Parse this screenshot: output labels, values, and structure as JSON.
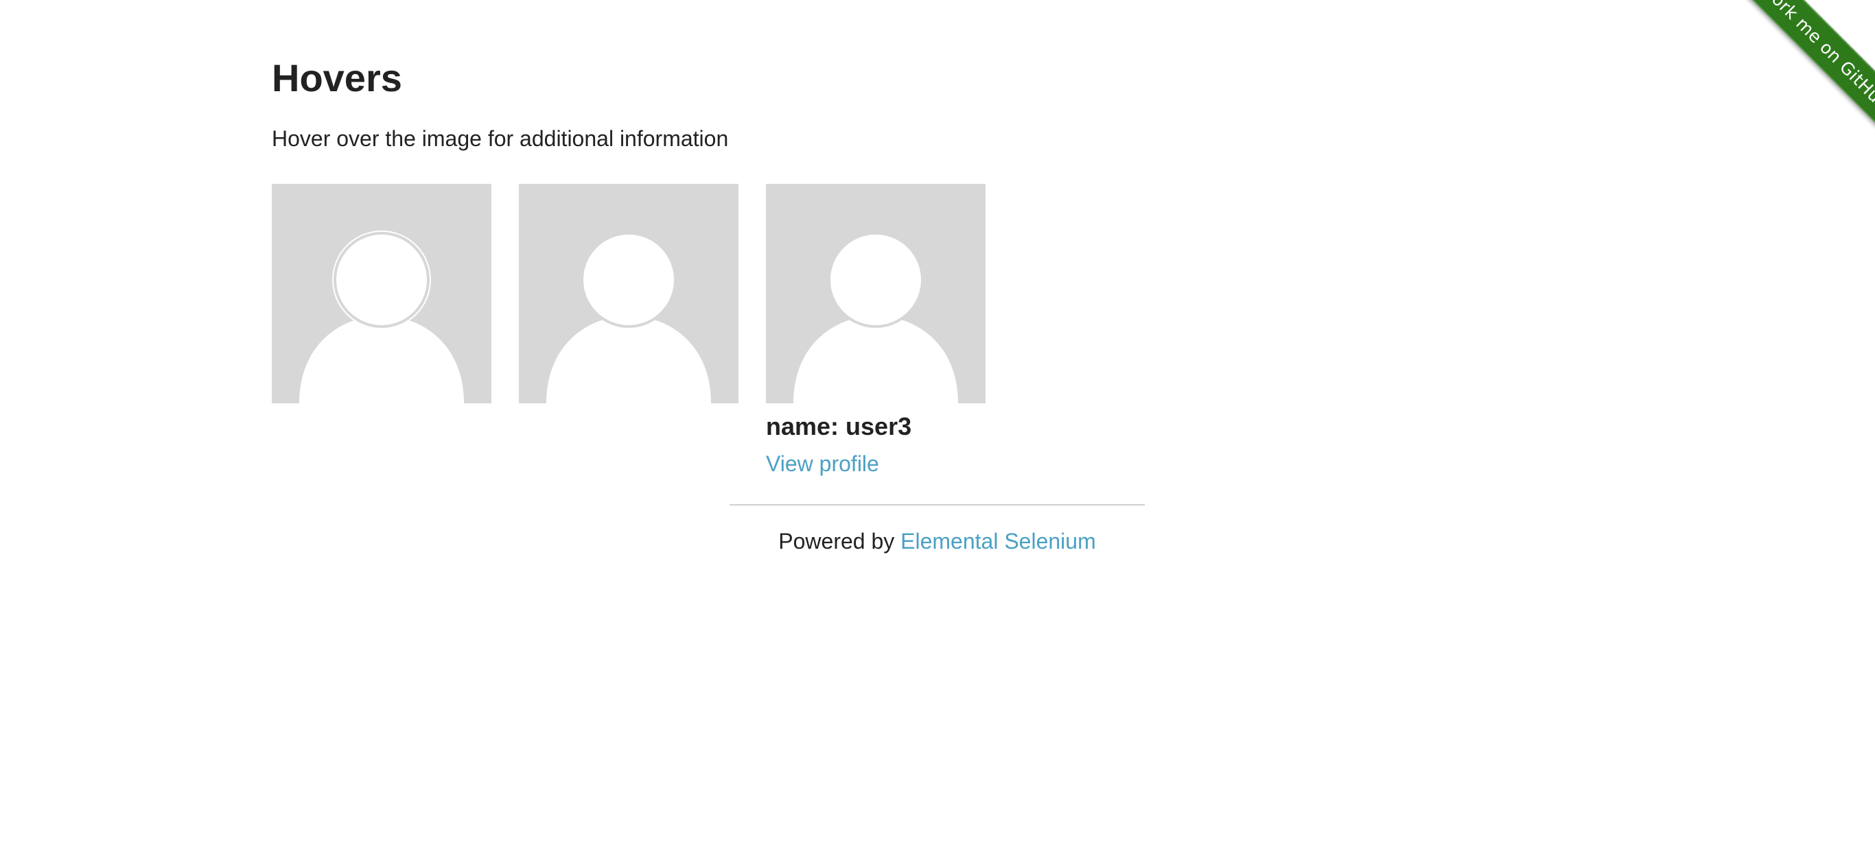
{
  "ribbon": {
    "label": "Fork me on GitHub",
    "color": "#2e7a1b"
  },
  "header": {
    "title": "Hovers"
  },
  "intro": {
    "text": "Hover over the image for additional information"
  },
  "figures": [
    {
      "avatar_icon": "user-avatar-icon"
    },
    {
      "avatar_icon": "user-avatar-icon"
    },
    {
      "avatar_icon": "user-avatar-icon",
      "caption_name": "name: user3",
      "caption_link": "View profile"
    }
  ],
  "footer": {
    "powered_by": "Powered by",
    "link_label": "Elemental Selenium"
  },
  "colors": {
    "link": "#4ba0c4",
    "avatar_bg": "#d7d7d7",
    "text": "#222222"
  }
}
